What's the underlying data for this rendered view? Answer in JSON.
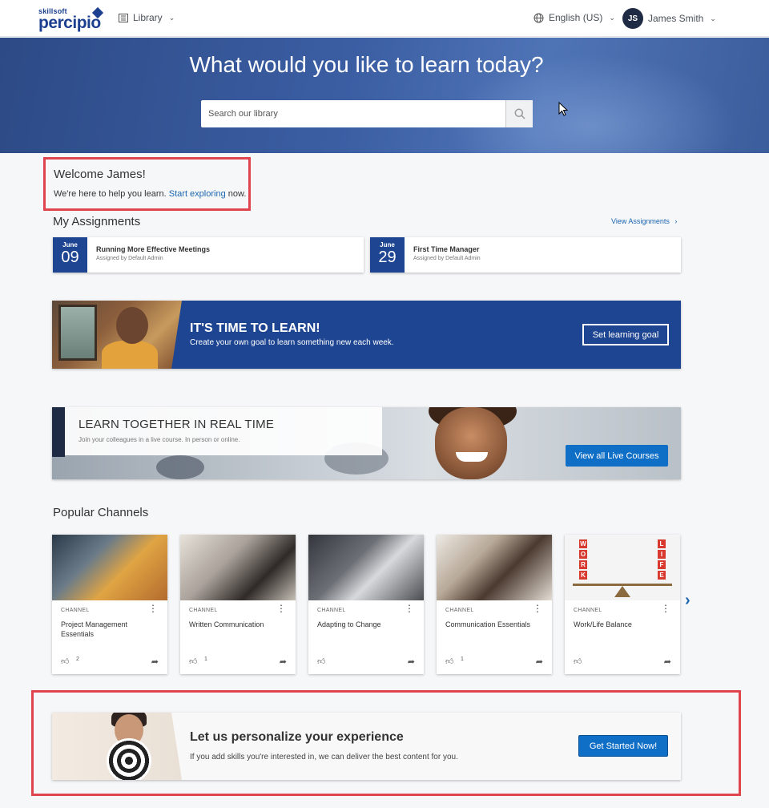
{
  "header": {
    "logo_small": "skillsoft",
    "logo_big": "percipio",
    "library_label": "Library",
    "language_label": "English (US)",
    "user_initials": "JS",
    "user_name": "James Smith"
  },
  "hero": {
    "heading": "What would you like to learn today?",
    "search_placeholder": "Search our library"
  },
  "welcome": {
    "title": "Welcome James!",
    "text_before": "We're here to help you learn.",
    "link": "Start exploring",
    "text_after": "now."
  },
  "assignments": {
    "title": "My Assignments",
    "view_all": "View Assignments",
    "items": [
      {
        "month": "June",
        "day": "09",
        "name": "Running More Effective Meetings",
        "by": "Assigned by Default Admin"
      },
      {
        "month": "June",
        "day": "29",
        "name": "First Time Manager",
        "by": "Assigned by Default Admin"
      }
    ]
  },
  "learn_banner": {
    "heading": "IT'S TIME TO LEARN!",
    "subtext": "Create your own goal to learn something new each week.",
    "button": "Set learning goal"
  },
  "live_banner": {
    "heading": "LEARN TOGETHER IN REAL TIME",
    "subtext": "Join your colleagues in a live course. In person or online.",
    "button": "View all Live Courses"
  },
  "channels": {
    "title": "Popular Channels",
    "items": [
      {
        "kind": "CHANNEL",
        "title": "Project Management Essentials",
        "likes": "2"
      },
      {
        "kind": "CHANNEL",
        "title": "Written Communication",
        "likes": "1"
      },
      {
        "kind": "CHANNEL",
        "title": "Adapting to Change",
        "likes": ""
      },
      {
        "kind": "CHANNEL",
        "title": "Communication Essentials",
        "likes": "1"
      },
      {
        "kind": "CHANNEL",
        "title": "Work/Life Balance",
        "likes": ""
      }
    ],
    "work_letters": [
      "W",
      "O",
      "R",
      "K"
    ],
    "life_letters": [
      "L",
      "I",
      "F",
      "E"
    ]
  },
  "personalize": {
    "heading": "Let us personalize your experience",
    "subtext": "If you add skills you're interested in, we can deliver the best content for you.",
    "button": "Get Started Now!"
  },
  "colors": {
    "brand_blue": "#1e4592",
    "button_blue": "#0f6ec6",
    "link_blue": "#1b65b0",
    "highlight_red": "#e0454f"
  }
}
